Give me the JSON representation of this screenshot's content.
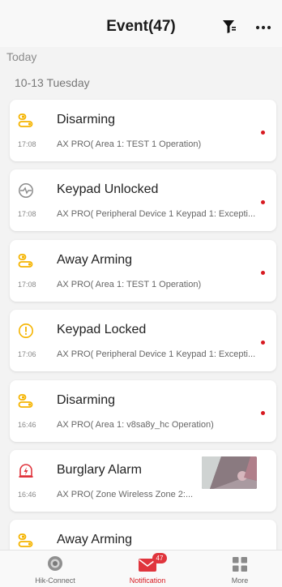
{
  "header": {
    "title": "Event(47)"
  },
  "today_label": "Today",
  "date_label": "10-13 Tuesday",
  "events": [
    {
      "title": "Disarming",
      "time": "17:08",
      "desc": "AX PRO( Area 1: TEST 1 Operation)",
      "icon": "arm-status-icon",
      "unread": true
    },
    {
      "title": "Keypad Unlocked",
      "time": "17:08",
      "desc": "AX PRO( Peripheral Device 1 Keypad 1: Excepti...",
      "icon": "keypad-unlocked-icon",
      "unread": true
    },
    {
      "title": "Away Arming",
      "time": "17:08",
      "desc": "AX PRO( Area 1: TEST 1 Operation)",
      "icon": "arm-status-icon",
      "unread": true
    },
    {
      "title": "Keypad Locked",
      "time": "17:06",
      "desc": "AX PRO( Peripheral Device 1 Keypad 1: Excepti...",
      "icon": "warning-icon",
      "unread": true
    },
    {
      "title": "Disarming",
      "time": "16:46",
      "desc": "AX PRO( Area 1: v8sa8y_hc Operation)",
      "icon": "arm-status-icon",
      "unread": true
    },
    {
      "title": "Burglary Alarm",
      "time": "16:46",
      "desc": "AX PRO( Zone Wireless Zone 2:...",
      "icon": "alarm-icon",
      "unread": false,
      "has_thumbnail": true
    },
    {
      "title": "Away Arming",
      "time": "",
      "desc": "",
      "icon": "arm-status-icon",
      "unread": false
    }
  ],
  "tabbar": {
    "hik_connect": "Hik-Connect",
    "notification": "Notification",
    "notification_badge": "47",
    "more": "More"
  },
  "colors": {
    "accent": "#d71920",
    "icon_yellow": "#f5b400"
  }
}
